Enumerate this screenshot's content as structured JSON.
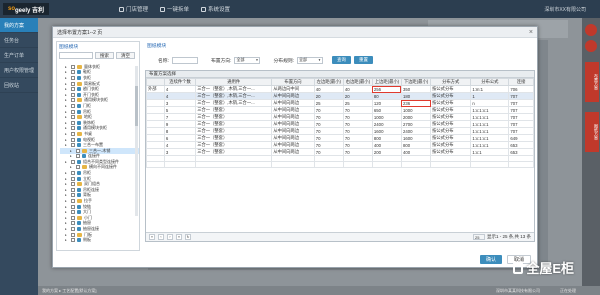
{
  "app": {
    "logo": "sogeely 吉利",
    "logo_prefix": "so",
    "logo_suffix": "geely 吉利",
    "nav": [
      "门店管理",
      "一键拆单",
      "系统设置"
    ],
    "user": "深圳市XX有限公司"
  },
  "sidebar": [
    "我的方案",
    "任务台",
    "生产订单",
    "用户权限管理",
    "回收站"
  ],
  "side_tabs": [
    "布置方案",
    "图纸方案"
  ],
  "bottom_bar": [
    "我的方案 ▸ 工艺配置[默认方案]",
    "深圳市某某科技有限公司",
    "正在处理"
  ],
  "modal": {
    "title": "选择布置方案1--2 页",
    "close": "×",
    "left_title": "图纸模块",
    "search_btn": "搜索",
    "clear_btn": "清空",
    "right_title": "图纸模块",
    "filter": {
      "name_label": "名称:",
      "direction_label": "布置方向:",
      "direction_value": "全部",
      "method_label": "分布规则:",
      "method_value": "全部",
      "query_btn": "查询",
      "reset_btn": "重置"
    },
    "grid_caption": "布置方案选择",
    "columns": [
      "",
      "连续件个数",
      "通用件",
      "布置方向",
      "左边距(最小)",
      "右边距(最小)",
      "上边距(最小)",
      "下边距(最小)",
      "分布方式",
      "分布公式",
      "连接"
    ],
    "rows": [
      [
        "外部",
        "4",
        "三合一（整套）,木销,三合一...",
        "从两边向中间",
        "40",
        "40",
        "256",
        "350",
        "按公式分布",
        "1:m:1",
        "706"
      ],
      [
        "",
        "4",
        "三合一（整套）,木销,三合一...",
        "从中间向两边",
        "20",
        "20",
        "80",
        "180",
        "按公式分布",
        "1",
        "707"
      ],
      [
        "",
        "3",
        "三合一（整套）,木销,三合一...",
        "从中间向两边",
        "25",
        "25",
        "120",
        "236",
        "按公式分布",
        "n",
        "707"
      ],
      [
        "",
        "5",
        "三合一（整套）",
        "从中间向两边",
        "70",
        "70",
        "650",
        "1000",
        "按公式分布",
        "1:x:1:x:1",
        "707"
      ],
      [
        "",
        "7",
        "三合一（整套）",
        "从中间向两边",
        "70",
        "70",
        "1000",
        "2000",
        "按公式分布",
        "1:x:1:x:1",
        "707"
      ],
      [
        "",
        "9",
        "三合一（整套）",
        "从中间向两边",
        "70",
        "70",
        "2400",
        "2700",
        "按公式分布",
        "1:x:1:x:1",
        "707"
      ],
      [
        "",
        "8",
        "三合一（整套）",
        "从中间向两边",
        "70",
        "70",
        "1600",
        "2400",
        "按公式分布",
        "1:x:1:x:1",
        "707"
      ],
      [
        "",
        "6",
        "三合一（整套）",
        "从中间向两边",
        "70",
        "70",
        "800",
        "1600",
        "按公式分布",
        "1:x:1:x:1",
        "649"
      ],
      [
        "",
        "4",
        "三合一（整套）",
        "从中间向两边",
        "70",
        "70",
        "400",
        "800",
        "按公式分布",
        "1:x:1:x:1",
        "653"
      ],
      [
        "",
        "3",
        "三合一（整套）",
        "从中间向两边",
        "70",
        "70",
        "200",
        "400",
        "按公式分布",
        "1:x:1",
        "653"
      ],
      [
        "",
        "",
        "",
        "",
        "",
        "",
        "",
        "",
        "",
        "",
        ""
      ],
      [
        "",
        "",
        "",
        "",
        "",
        "",
        "",
        "",
        "",
        "",
        ""
      ]
    ],
    "pager": {
      "page_size": "25",
      "info": "显示1 - 25 条,共 13 条"
    },
    "ok_btn": "确认",
    "cancel_btn": "取消"
  },
  "tree": [
    {
      "label": "量体衣柜",
      "depth": 1
    },
    {
      "label": "鞋柜",
      "depth": 1
    },
    {
      "label": "衣柜",
      "depth": 1
    },
    {
      "label": "简易板式",
      "depth": 1
    },
    {
      "label": "趟门衣柜",
      "depth": 1
    },
    {
      "label": "开门衣柜",
      "depth": 1
    },
    {
      "label": "通用模块衣柜",
      "depth": 1
    },
    {
      "label": "门柜",
      "depth": 1
    },
    {
      "label": "吊柜",
      "depth": 1
    },
    {
      "label": "地柜",
      "depth": 1
    },
    {
      "label": "装饰柜",
      "depth": 1
    },
    {
      "label": "通用模块衣柜",
      "depth": 1
    },
    {
      "label": "书桌",
      "depth": 1
    },
    {
      "label": "电视柜",
      "depth": 1
    },
    {
      "label": "三合一布置",
      "depth": 1
    },
    {
      "label": "三合一-木销",
      "depth": 2,
      "selected": true
    },
    {
      "label": "连接件",
      "depth": 2
    },
    {
      "label": "组合不同类型连接件",
      "depth": 1
    },
    {
      "label": "横向不同连接件",
      "depth": 2
    },
    {
      "label": "吊柜",
      "depth": 1
    },
    {
      "label": "立柜",
      "depth": 1
    },
    {
      "label": "双门组合",
      "depth": 1
    },
    {
      "label": "吊柜连接",
      "depth": 1
    },
    {
      "label": "背板",
      "depth": 1
    },
    {
      "label": "拉手",
      "depth": 1
    },
    {
      "label": "铰链",
      "depth": 1
    },
    {
      "label": "大门",
      "depth": 1
    },
    {
      "label": "小门",
      "depth": 1
    },
    {
      "label": "抽屉",
      "depth": 1
    },
    {
      "label": "抽屉连接",
      "depth": 1
    },
    {
      "label": "门板",
      "depth": 1
    },
    {
      "label": "侧板",
      "depth": 1
    }
  ],
  "watermark": "全屋E柜"
}
